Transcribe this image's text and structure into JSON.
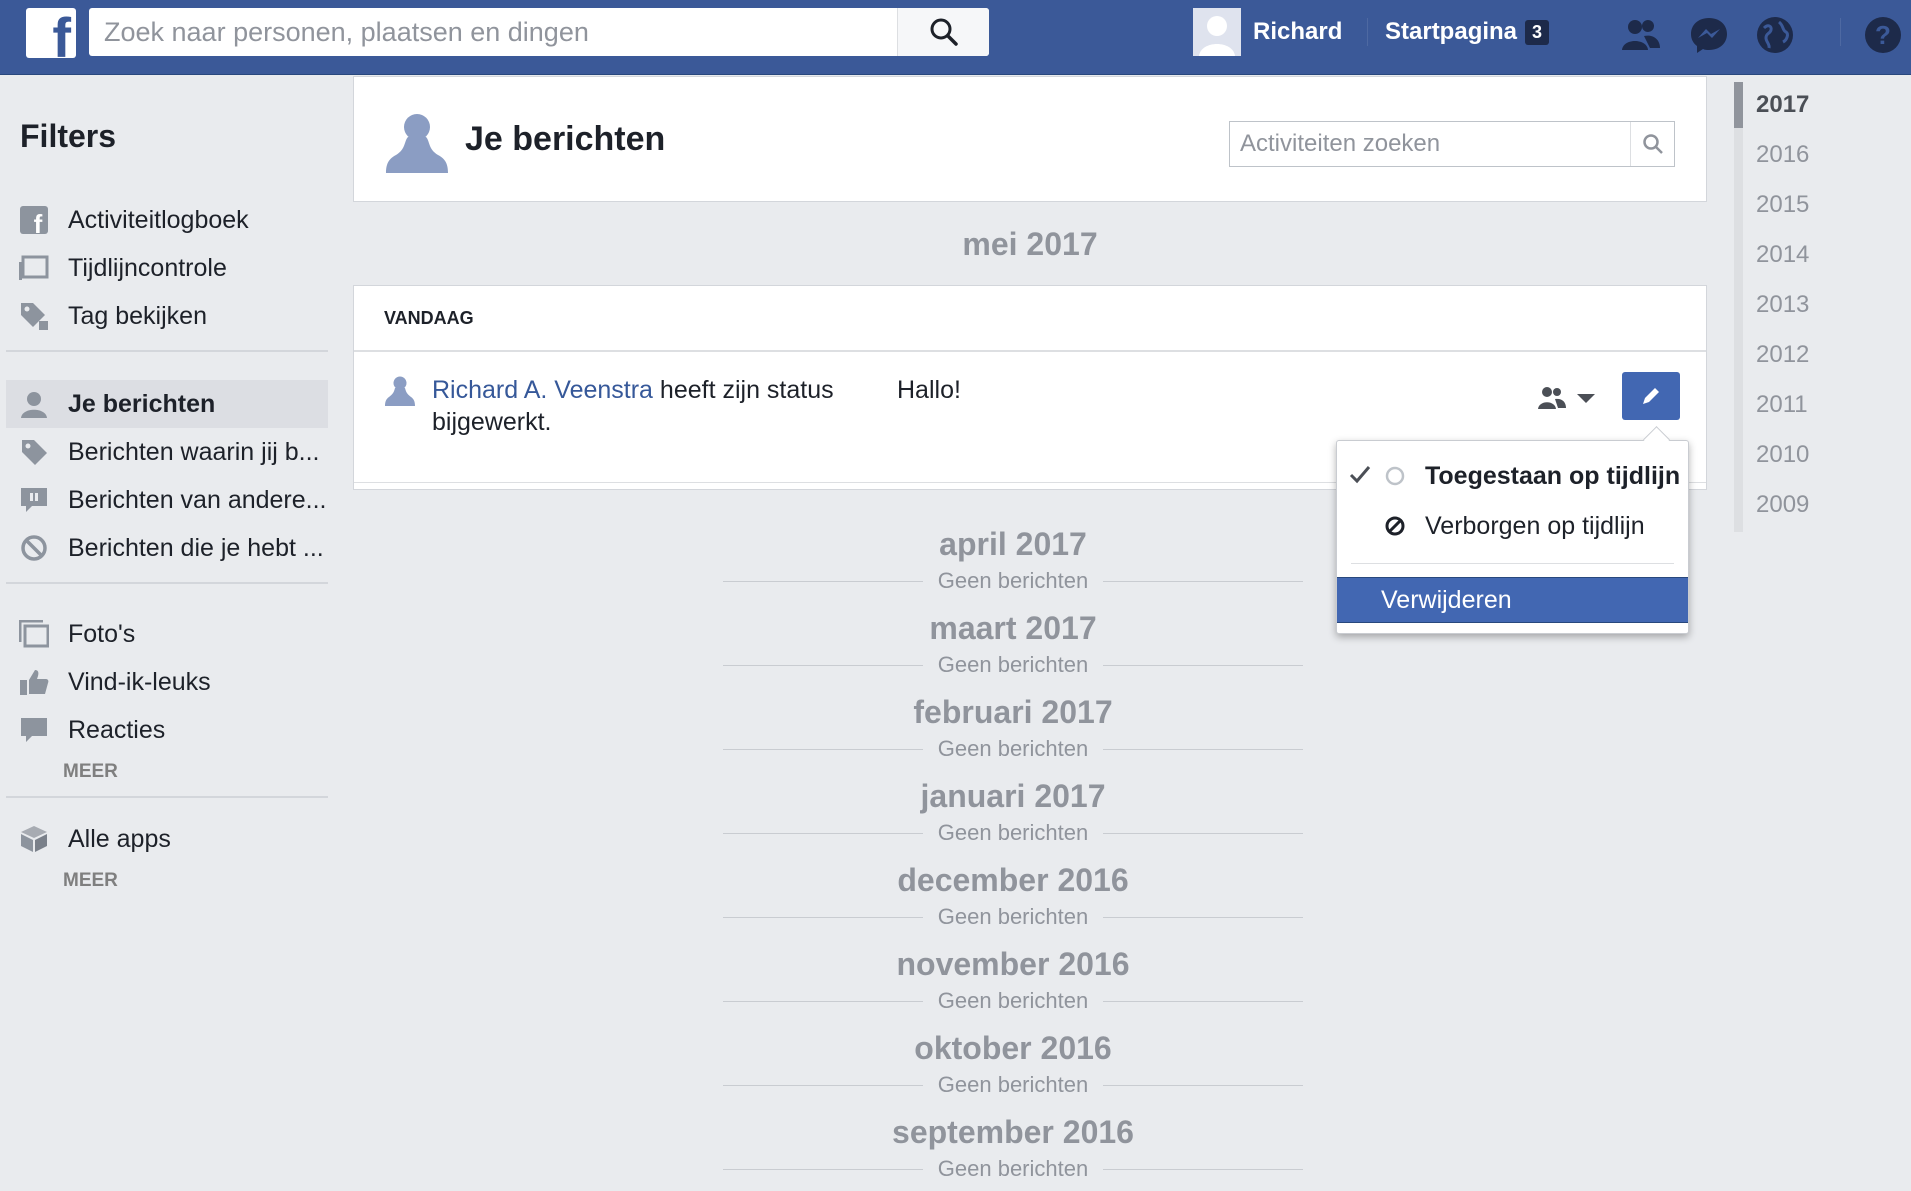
{
  "topbar": {
    "search_placeholder": "Zoek naar personen, plaatsen en dingen",
    "user_name": "Richard",
    "home_label": "Startpagina",
    "home_badge": "3"
  },
  "sidebar": {
    "title": "Filters",
    "group1": [
      {
        "label": "Activiteitlogboek",
        "icon": "facebook-icon"
      },
      {
        "label": "Tijdlijncontrole",
        "icon": "timeline-review-icon"
      },
      {
        "label": "Tag bekijken",
        "icon": "tag-review-icon"
      }
    ],
    "group2": [
      {
        "label": "Je berichten",
        "icon": "person-icon",
        "active": true
      },
      {
        "label": "Berichten waarin jij b...",
        "icon": "tag-icon"
      },
      {
        "label": "Berichten van andere...",
        "icon": "comment-icon"
      },
      {
        "label": "Berichten die je hebt ...",
        "icon": "hidden-icon"
      }
    ],
    "group3": [
      {
        "label": "Foto's",
        "icon": "photos-icon"
      },
      {
        "label": "Vind-ik-leuks",
        "icon": "like-icon"
      },
      {
        "label": "Reacties",
        "icon": "comments-icon"
      }
    ],
    "more1": "MEER",
    "group4": [
      {
        "label": "Alle apps",
        "icon": "apps-icon"
      }
    ],
    "more2": "MEER"
  },
  "header": {
    "title": "Je berichten",
    "search_placeholder": "Activiteiten zoeken"
  },
  "current_month": "mei 2017",
  "feed": {
    "section": "VANDAAG",
    "author": "Richard A. Veenstra",
    "action": " heeft zijn status bijgewerkt.",
    "status": "Hallo!"
  },
  "dropdown": {
    "allowed": "Toegestaan op tijdlijn",
    "hidden": "Verborgen op tijdlijn",
    "delete": "Verwijderen"
  },
  "empty_months": [
    {
      "month": "april 2017",
      "note": "Geen berichten"
    },
    {
      "month": "maart 2017",
      "note": "Geen berichten"
    },
    {
      "month": "februari 2017",
      "note": "Geen berichten"
    },
    {
      "month": "januari 2017",
      "note": "Geen berichten"
    },
    {
      "month": "december 2016",
      "note": "Geen berichten"
    },
    {
      "month": "november 2016",
      "note": "Geen berichten"
    },
    {
      "month": "oktober 2016",
      "note": "Geen berichten"
    },
    {
      "month": "september 2016",
      "note": "Geen berichten"
    }
  ],
  "years": [
    "2017",
    "2016",
    "2015",
    "2014",
    "2013",
    "2012",
    "2011",
    "2010",
    "2009"
  ],
  "colors": {
    "brand": "#3b5998",
    "link": "#365899",
    "button": "#4267b2",
    "page_bg": "#e9ebee"
  }
}
